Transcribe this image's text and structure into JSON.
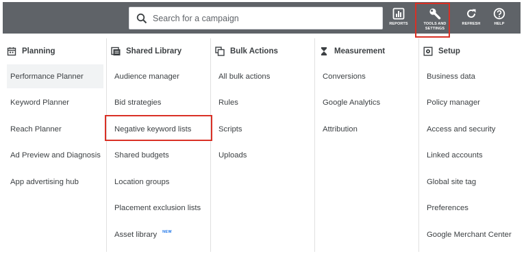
{
  "search": {
    "placeholder": "Search for a campaign"
  },
  "toolbar": [
    {
      "label": "REPORTS",
      "icon": "reports-icon"
    },
    {
      "label": "TOOLS AND\nSETTINGS",
      "icon": "wrench-icon"
    },
    {
      "label": "REFRESH",
      "icon": "refresh-icon"
    },
    {
      "label": "HELP",
      "icon": "help-icon"
    }
  ],
  "columns": [
    {
      "title": "Planning",
      "icon": "calendar-icon",
      "items": [
        "Performance Planner",
        "Keyword Planner",
        "Reach Planner",
        "Ad Preview and Diagnosis",
        "App advertising hub"
      ]
    },
    {
      "title": "Shared Library",
      "icon": "library-icon",
      "items": [
        "Audience manager",
        "Bid strategies",
        "Negative keyword lists",
        "Shared budgets",
        "Location groups",
        "Placement exclusion lists",
        "Asset library"
      ],
      "badge": "NEW"
    },
    {
      "title": "Bulk Actions",
      "icon": "copy-icon",
      "items": [
        "All bulk actions",
        "Rules",
        "Scripts",
        "Uploads"
      ]
    },
    {
      "title": "Measurement",
      "icon": "hourglass-icon",
      "items": [
        "Conversions",
        "Google Analytics",
        "Attribution"
      ]
    },
    {
      "title": "Setup",
      "icon": "settings-box-icon",
      "items": [
        "Business data",
        "Policy manager",
        "Access and security",
        "Linked accounts",
        "Global site tag",
        "Preferences",
        "Google Merchant Center"
      ]
    }
  ],
  "colors": {
    "topbar": "#5f6368",
    "highlight": "#d93025",
    "active_item_bg": "#f1f3f4",
    "badge": "#1a73e8"
  }
}
